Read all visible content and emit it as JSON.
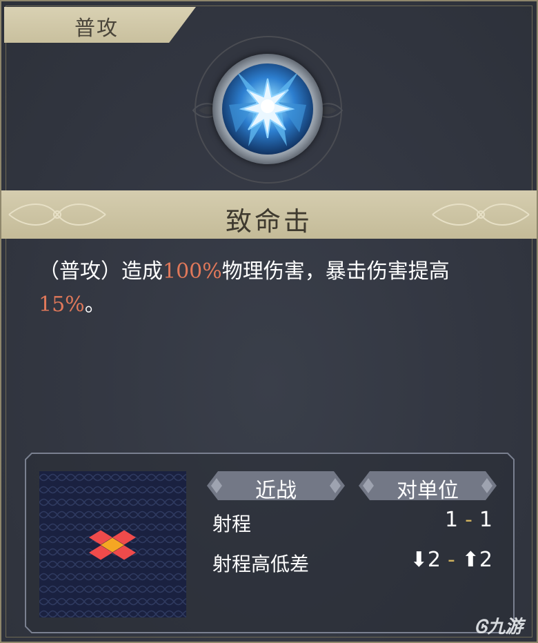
{
  "skill": {
    "tab_label": "普攻",
    "name": "致命击",
    "icon": "star-burst-icon",
    "description": {
      "part1": "（普攻）造成",
      "damage_value": "100%",
      "part2": "物理伤害，暴击伤害提高",
      "crit_bonus": "15%",
      "part3": "。"
    }
  },
  "attributes": {
    "attack_type": "近战",
    "target_type": "对单位",
    "range_label": "射程",
    "range_min": "1",
    "range_sep": "-",
    "range_max": "1",
    "height_label": "射程高低差",
    "height_down": "2",
    "height_sep": "-",
    "height_up": "2"
  },
  "range_map": {
    "center_color": "#f5a623",
    "cell_color": "#ef4b4b"
  },
  "watermark": "九游",
  "colors": {
    "highlight": "#e0785a",
    "gold": "#c9c09e",
    "background": "#343843"
  }
}
